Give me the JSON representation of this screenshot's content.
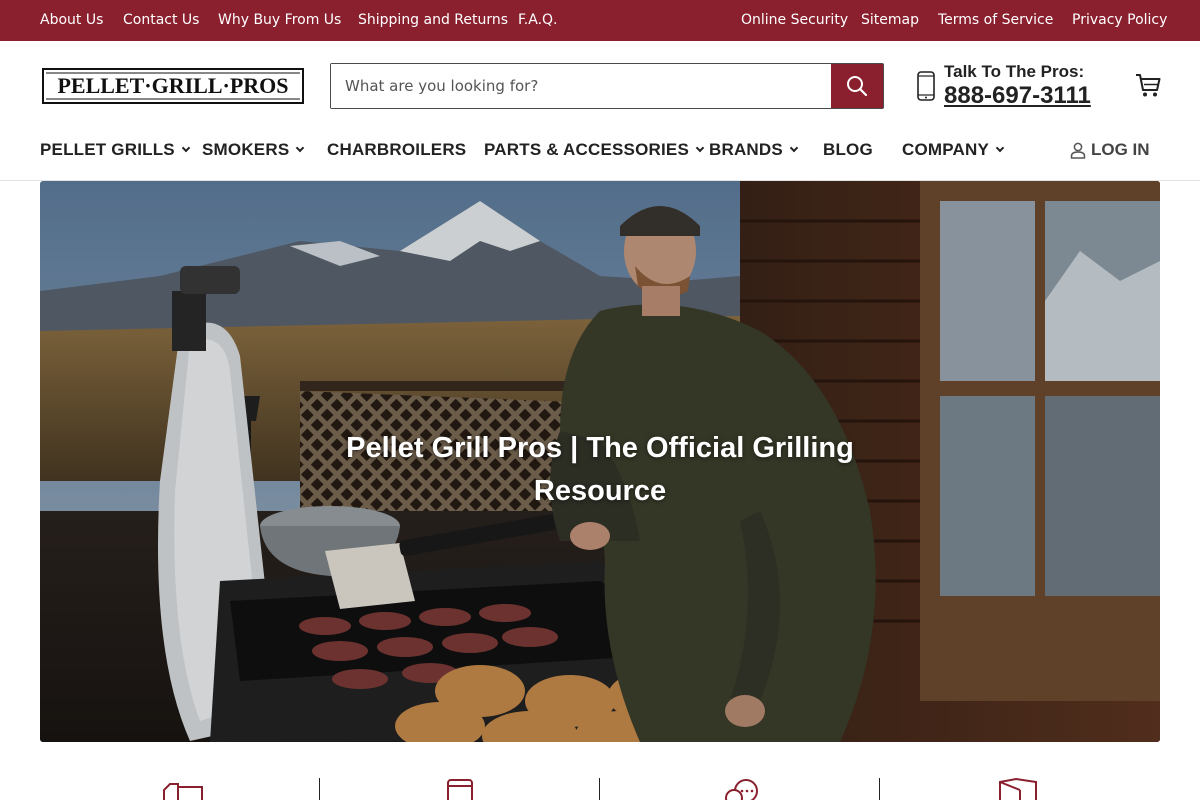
{
  "topbar": {
    "left_links": [
      {
        "label": "About Us"
      },
      {
        "label": "Contact Us"
      },
      {
        "label": "Why Buy From Us"
      },
      {
        "label": "Shipping and Returns"
      },
      {
        "label": "F.A.Q."
      }
    ],
    "right_links": [
      {
        "label": "Online Security"
      },
      {
        "label": "Sitemap"
      },
      {
        "label": "Terms of Service"
      },
      {
        "label": "Privacy Policy"
      }
    ]
  },
  "header": {
    "logo_text": "PELLET·GRILL·PROS",
    "search_placeholder": "What are you looking for?",
    "search_value": "",
    "search_icon": "search-icon",
    "talk_label": "Talk To The Pros:",
    "phone": "888-697-3111",
    "phone_icon": "mobile-phone-icon",
    "cart_icon": "shopping-cart-icon"
  },
  "nav": {
    "items": [
      {
        "label": "PELLET GRILLS",
        "has_dropdown": true
      },
      {
        "label": "SMOKERS",
        "has_dropdown": true
      },
      {
        "label": "CHARBROILERS",
        "has_dropdown": false
      },
      {
        "label": "PARTS & ACCESSORIES",
        "has_dropdown": true
      },
      {
        "label": "BRANDS",
        "has_dropdown": true
      },
      {
        "label": "BLOG",
        "has_dropdown": false
      },
      {
        "label": "COMPANY",
        "has_dropdown": true
      }
    ],
    "login_label": "LOG IN",
    "login_icon": "user-icon"
  },
  "hero": {
    "title": "Pellet Grill Pros | The Official Grilling Resource"
  },
  "features": {
    "icons": [
      "shipping-truck-icon",
      "mobile-device-icon",
      "chat-bubbles-icon",
      "box-icon"
    ]
  },
  "colors": {
    "brand": "#8a1f2e",
    "text": "#222222"
  }
}
